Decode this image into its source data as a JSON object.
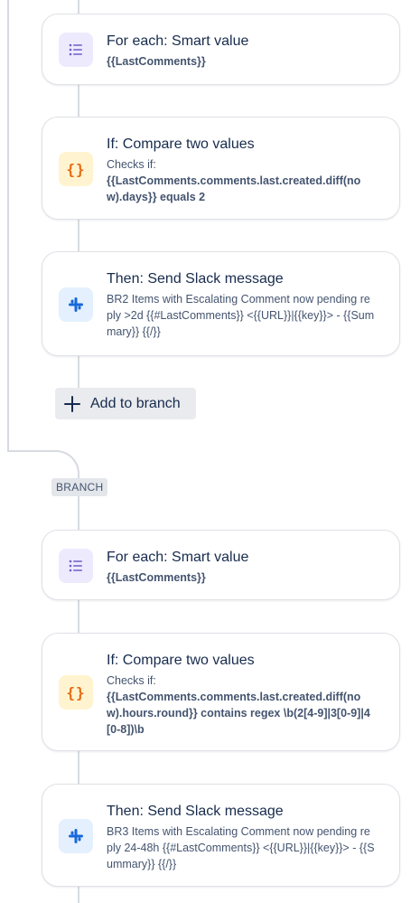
{
  "section1": {
    "foreach": {
      "title": "For each: Smart value",
      "value": "{{LastComments}}",
      "icon": "list-icon"
    },
    "if": {
      "title": "If: Compare two values",
      "checks_label": "Checks if:",
      "condition": "{{LastComments.comments.last.created.diff(now).days}} equals 2",
      "icon": "braces-icon"
    },
    "then": {
      "title": "Then: Send Slack message",
      "message": "BR2 Items with Escalating Comment now pending reply >2d {{#LastComments}} <{{URL}}|{{key}}> - {{Summary}} {{/}}",
      "icon": "slack-icon"
    }
  },
  "add_to_branch_label": "Add to branch",
  "branch_label": "BRANCH",
  "section2": {
    "foreach": {
      "title": "For each: Smart value",
      "value": "{{LastComments}}",
      "icon": "list-icon"
    },
    "if": {
      "title": "If: Compare two values",
      "checks_label": "Checks if:",
      "condition": "{{LastComments.comments.last.created.diff(now).hours.round}} contains regex \\b(2[4-9]|3[0-9]|4[0-8])\\b",
      "icon": "braces-icon"
    },
    "then": {
      "title": "Then: Send Slack message",
      "message": "BR3 Items with Escalating Comment now pending reply 24-48h {{#LastComments}} <{{URL}}|{{key}}> - {{Summary}} {{/}}",
      "icon": "slack-icon"
    }
  }
}
